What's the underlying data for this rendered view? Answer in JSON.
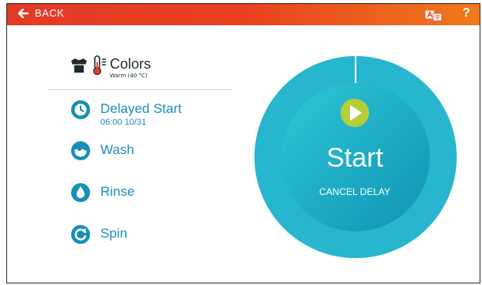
{
  "header": {
    "back_label": "BACK",
    "help_label": "?"
  },
  "program": {
    "name": "Colors",
    "temperature": "Warm (40 °C)"
  },
  "steps": [
    {
      "label": "Delayed Start",
      "sub": "06:00 10/31",
      "icon": "clock-icon"
    },
    {
      "label": "Wash",
      "icon": "wash-icon"
    },
    {
      "label": "Rinse",
      "icon": "water-drop-icon"
    },
    {
      "label": "Spin",
      "icon": "spin-icon"
    }
  ],
  "dial": {
    "start_label": "Start",
    "cancel_label": "CANCEL DELAY",
    "progress": 0
  },
  "colors": {
    "topbar_start": "#e23a27",
    "topbar_end": "#f07a1c",
    "teal": "#1a8fb5",
    "dial_outer": "#26b6cf",
    "dial_inner": "#1aa5c0",
    "play": "#b5cf3b"
  }
}
